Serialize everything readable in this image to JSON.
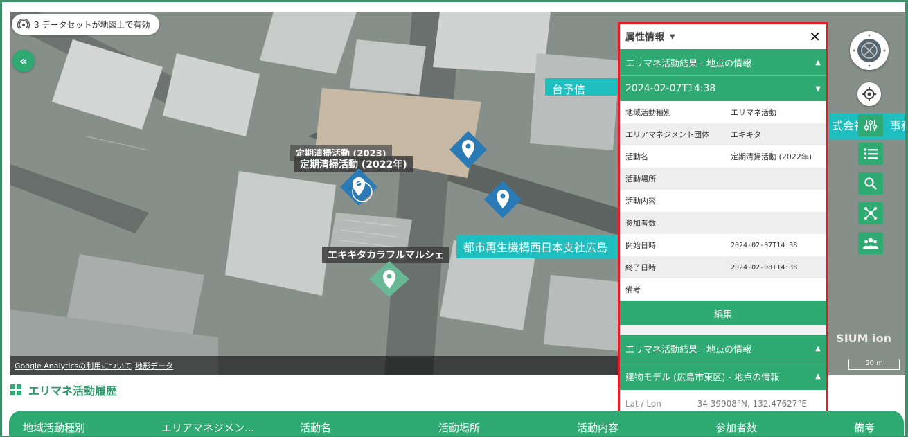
{
  "map": {
    "dataset_notice": "3 データセットが地図上で有効",
    "labels": {
      "cleanup_2023": "定期清掃活動 (2023)",
      "cleanup_2022": "定期清掃活動 (2022年)",
      "marche": "エキキタカラフルマルシェ",
      "ur_office": "都市再生機構西日本支社広島",
      "company": "式会社",
      "office": "事務",
      "forecast": "台予信"
    },
    "attribution": {
      "analytics": "Google Analyticsの利用について",
      "terrain": "地形データ"
    },
    "scale": "50 m",
    "cesium": "SIUM ion"
  },
  "panel": {
    "title": "属性情報",
    "section1": "エリマネ活動結果 - 地点の情報",
    "timestamp": "2024-02-07T14:38",
    "rows": [
      {
        "k": "地域活動種別",
        "v": "エリマネ活動"
      },
      {
        "k": "エリアマネジメント団体",
        "v": "エキキタ"
      },
      {
        "k": "活動名",
        "v": "定期清掃活動 (2022年)"
      },
      {
        "k": "活動場所",
        "v": ""
      },
      {
        "k": "活動内容",
        "v": ""
      },
      {
        "k": "参加者数",
        "v": ""
      },
      {
        "k": "開始日時",
        "v": "2024-02-07T14:38"
      },
      {
        "k": "終了日時",
        "v": "2024-02-08T14:38"
      },
      {
        "k": "備考",
        "v": ""
      }
    ],
    "edit_label": "編集",
    "section2": "エリマネ活動結果 - 地点の情報",
    "section3": "建物モデル (広島市東区) - 地点の情報",
    "latlon_label": "Lat / Lon",
    "latlon_value": "34.39908°N, 132.47627°E"
  },
  "history": {
    "title": "エリマネ活動履歴",
    "columns": [
      "地域活動種別",
      "エリアマネジメン...",
      "活動名",
      "活動場所",
      "活動内容",
      "参加者数",
      "備考"
    ]
  },
  "colors": {
    "accent": "#2eaa72",
    "highlight": "#e01f2a",
    "pin_blue": "#2a7bb5",
    "pin_green": "#69b895",
    "cyan": "#1fbfbf"
  }
}
